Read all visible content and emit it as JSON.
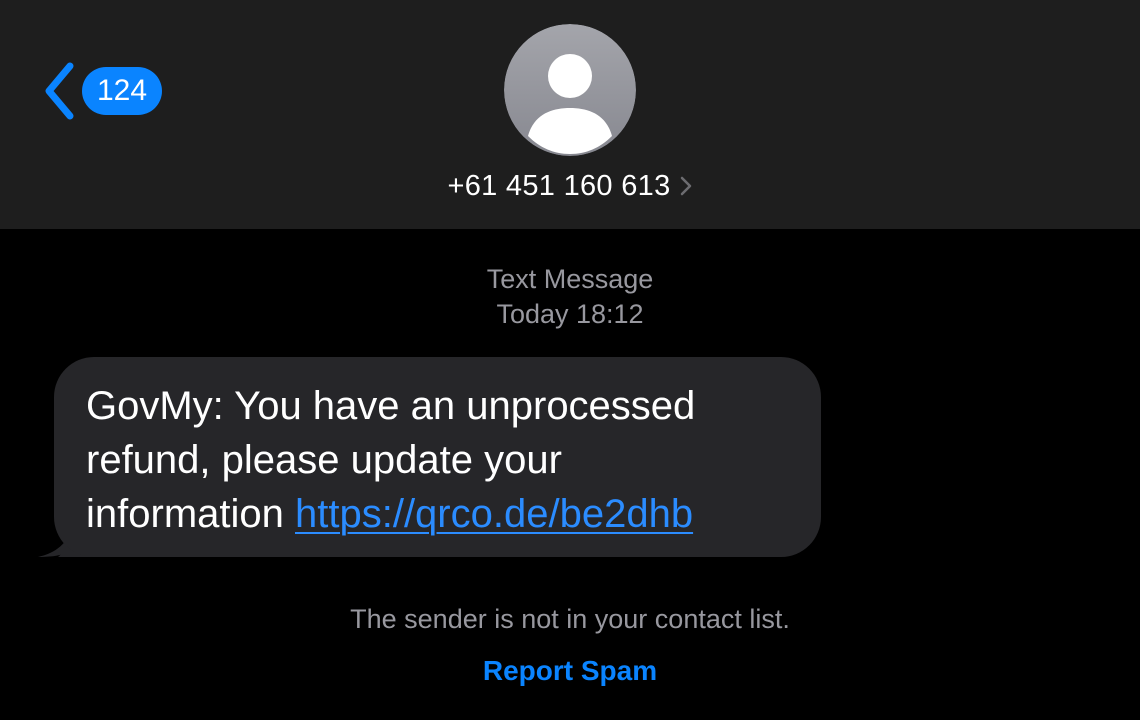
{
  "header": {
    "back_count": "124",
    "contact_number": "+61 451 160 613"
  },
  "thread": {
    "channel_label": "Text Message",
    "timestamp": "Today 18:12"
  },
  "message": {
    "text_line1": "GovMy: You have an unprocessed",
    "text_line2": "refund, please update your",
    "text_line3_prefix": "information",
    "link": "https://qrco.de/be2dhb"
  },
  "footer": {
    "notice": "The sender is not in your contact list.",
    "report_spam_label": "Report Spam"
  },
  "colors": {
    "accent": "#0a84ff",
    "link": "#2b8cff",
    "header_bg": "#1e1e1e",
    "bubble_bg": "#262629",
    "secondary_text": "#98989f"
  },
  "icons": {
    "back": "chevron-left-icon",
    "avatar": "person-placeholder-icon",
    "contact_details": "chevron-right-icon"
  }
}
